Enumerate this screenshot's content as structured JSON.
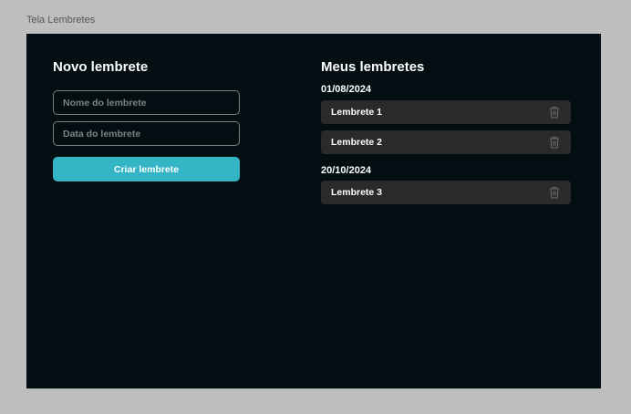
{
  "frame_title": "Tela Lembretes",
  "form": {
    "title": "Novo lembrete",
    "name_placeholder": "Nome do lembrete",
    "date_placeholder": "Data do lembrete",
    "submit_label": "Criar lembrete"
  },
  "list": {
    "title": "Meus lembretes",
    "groups": [
      {
        "date": "01/08/2024",
        "items": [
          {
            "label": "Lembrete 1",
            "icon": "trash-icon"
          },
          {
            "label": "Lembrete 2",
            "icon": "trash-icon"
          }
        ]
      },
      {
        "date": "20/10/2024",
        "items": [
          {
            "label": "Lembrete 3",
            "icon": "trash-icon"
          }
        ]
      }
    ]
  },
  "colors": {
    "accent": "#33b5c6",
    "background": "#020e12",
    "card": "#2a2a2a"
  }
}
